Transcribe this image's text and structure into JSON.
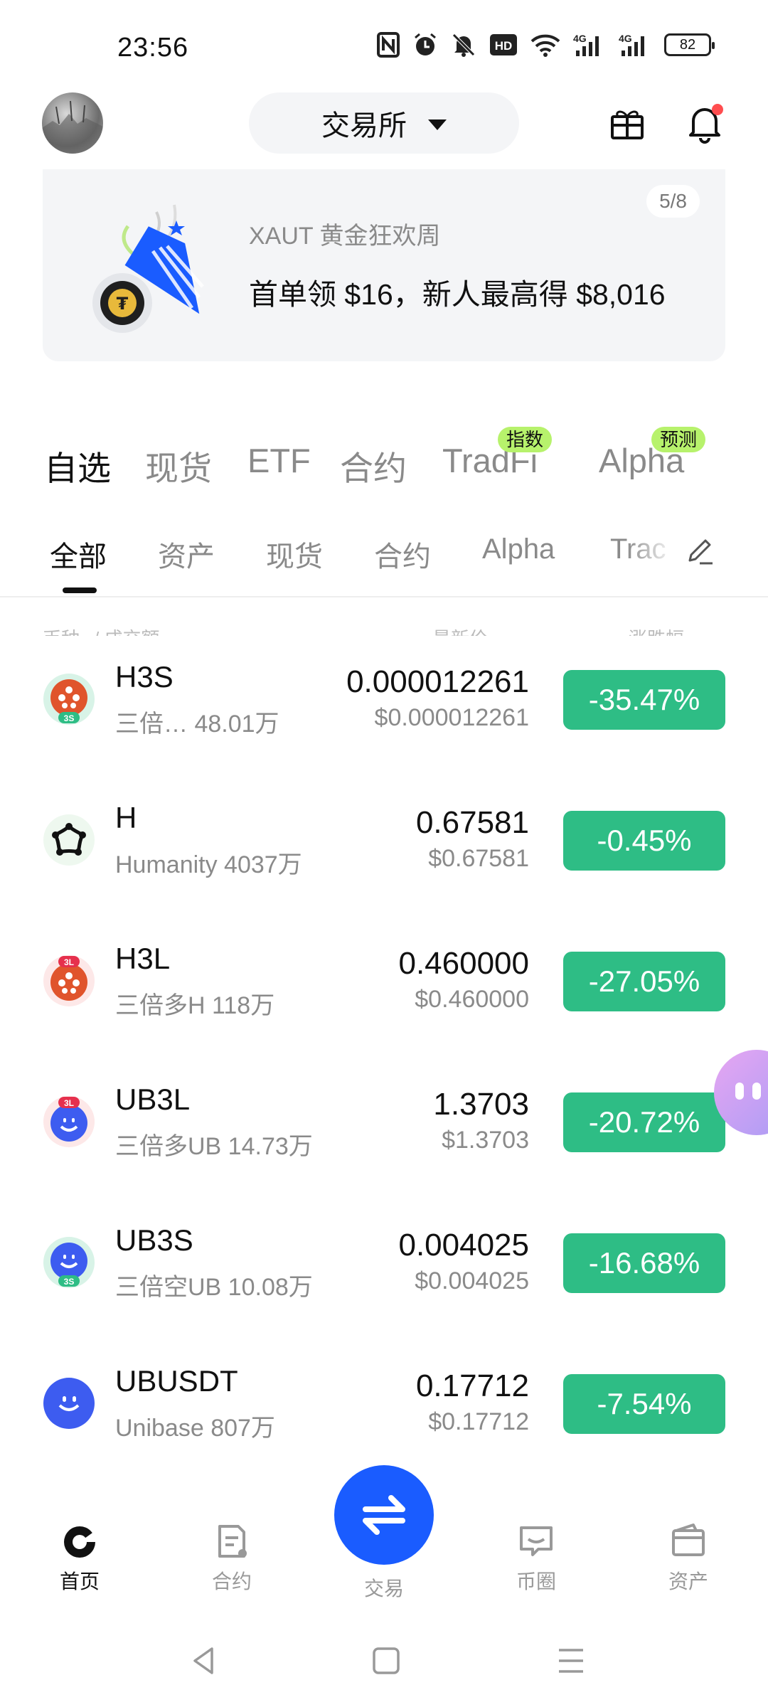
{
  "status_bar": {
    "time": "23:56",
    "network_1": "4G",
    "network_2": "4G",
    "battery": "82"
  },
  "header": {
    "exchange_label": "交易所"
  },
  "banner": {
    "counter": "5/8",
    "title": "XAUT 黄金狂欢周",
    "text": "首单领 $16，新人最高得 $8,016"
  },
  "top_tabs": [
    {
      "label": "自选",
      "tag": ""
    },
    {
      "label": "现货",
      "tag": ""
    },
    {
      "label": "ETF",
      "tag": ""
    },
    {
      "label": "合约",
      "tag": ""
    },
    {
      "label": "TradFi",
      "tag": "指数"
    },
    {
      "label": "Alpha",
      "tag": "预测"
    }
  ],
  "sub_tabs": [
    "全部",
    "资产",
    "现货",
    "合约",
    "Alpha",
    "Trac"
  ],
  "column_headers": [
    "币种",
    "/ 成交额",
    "最新价",
    "涨跌幅"
  ],
  "rows": [
    {
      "symbol": "H3S",
      "sub": "三倍…  48.01万",
      "price": "0.000012261",
      "price_usd": "$0.000012261",
      "change": "-35.47%"
    },
    {
      "symbol": "H",
      "sub": "Humanity 4037万",
      "price": "0.67581",
      "price_usd": "$0.67581",
      "change": "-0.45%"
    },
    {
      "symbol": "H3L",
      "sub": "三倍多H 118万",
      "price": "0.460000",
      "price_usd": "$0.460000",
      "change": "-27.05%"
    },
    {
      "symbol": "UB3L",
      "sub": "三倍多UB 14.73万",
      "price": "1.3703",
      "price_usd": "$1.3703",
      "change": "-20.72%"
    },
    {
      "symbol": "UB3S",
      "sub": "三倍空UB 10.08万",
      "price": "0.004025",
      "price_usd": "$0.004025",
      "change": "-16.68%"
    },
    {
      "symbol": "UBUSDT",
      "sub": "Unibase 807万",
      "price": "0.17712",
      "price_usd": "$0.17712",
      "change": "-7.54%"
    }
  ],
  "icon_badges": {
    "h3s": "3S",
    "h3l": "3L",
    "ub3l": "3L",
    "ub3s": "3S"
  },
  "bottom_nav": [
    {
      "label": "首页"
    },
    {
      "label": "合约"
    },
    {
      "label": "交易"
    },
    {
      "label": "币圈"
    },
    {
      "label": "资产"
    }
  ],
  "colors": {
    "accent": "#1a5cff",
    "change_bg": "#2ebd85",
    "tag_bg": "#b7f26c",
    "h_coin": "#e0542c",
    "ub_coin": "#3d5cf0"
  }
}
